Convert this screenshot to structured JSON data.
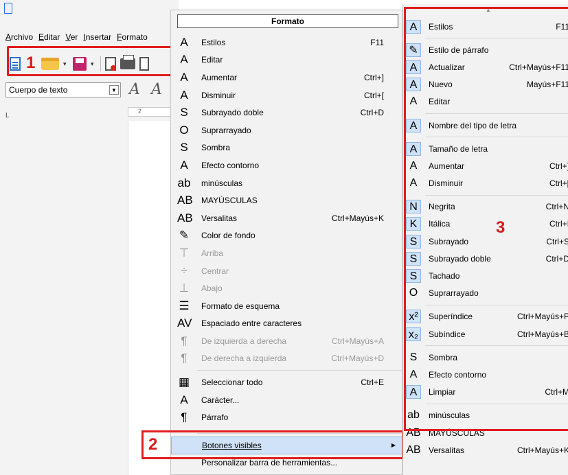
{
  "writer": {
    "menubar": [
      "Archivo",
      "Editar",
      "Ver",
      "Insertar",
      "Formato"
    ],
    "paragraph_style": "Cuerpo de texto",
    "ruler_marker": "L",
    "ruler_number": "2"
  },
  "callouts": {
    "one": "1",
    "two": "2",
    "three": "3"
  },
  "accent_color": "#e01d1d",
  "highlight_color": "#cfe2f7",
  "formato": {
    "title": "Formato",
    "items": [
      {
        "label": "Estilos",
        "shortcut": "F11",
        "icon": "estilos-icon",
        "glyph": "A"
      },
      {
        "label": "Editar",
        "shortcut": "",
        "icon": "editar-icon",
        "glyph": "A"
      },
      {
        "label": "Aumentar",
        "shortcut": "Ctrl+]",
        "icon": "aumentar-icon",
        "glyph": "A"
      },
      {
        "label": "Disminuir",
        "shortcut": "Ctrl+[",
        "icon": "disminuir-icon",
        "glyph": "A"
      },
      {
        "label": "Subrayado doble",
        "shortcut": "Ctrl+D",
        "icon": "subrayado-doble-icon",
        "glyph": "S"
      },
      {
        "label": "Suprarrayado",
        "shortcut": "",
        "icon": "suprarrayado-icon",
        "glyph": "O"
      },
      {
        "label": "Sombra",
        "shortcut": "",
        "icon": "sombra-icon",
        "glyph": "S"
      },
      {
        "label": "Efecto contorno",
        "shortcut": "",
        "icon": "contorno-icon",
        "glyph": "A"
      },
      {
        "label": "minúsculas",
        "shortcut": "",
        "icon": "minusculas-icon",
        "glyph": "ab"
      },
      {
        "label": "MAYÚSCULAS",
        "shortcut": "",
        "icon": "mayusculas-icon",
        "glyph": "AB"
      },
      {
        "label": "Versalitas",
        "shortcut": "Ctrl+Mayús+K",
        "icon": "versalitas-icon",
        "glyph": "AB"
      },
      {
        "label": "Color de fondo",
        "shortcut": "",
        "icon": "color-fondo-icon",
        "glyph": "✎"
      },
      {
        "label": "Arriba",
        "shortcut": "",
        "icon": "arriba-icon",
        "glyph": "⊤",
        "disabled": true
      },
      {
        "label": "Centrar",
        "shortcut": "",
        "icon": "centrar-icon",
        "glyph": "÷",
        "disabled": true
      },
      {
        "label": "Abajo",
        "shortcut": "",
        "icon": "abajo-icon",
        "glyph": "⊥",
        "disabled": true
      },
      {
        "label": "Formato de esquema",
        "shortcut": "",
        "icon": "esquema-icon",
        "glyph": "☰"
      },
      {
        "label": "Espaciado entre caracteres",
        "shortcut": "",
        "icon": "espaciado-icon",
        "glyph": "AV"
      },
      {
        "label": "De izquierda a derecha",
        "shortcut": "Ctrl+Mayús+A",
        "icon": "ltr-icon",
        "glyph": "¶",
        "disabled": true
      },
      {
        "label": "De derecha a izquierda",
        "shortcut": "Ctrl+Mayús+D",
        "icon": "rtl-icon",
        "glyph": "¶",
        "disabled": true
      },
      {
        "label": "Seleccionar todo",
        "shortcut": "Ctrl+E",
        "icon": "seleccionar-todo-icon",
        "glyph": "▦"
      },
      {
        "label": "Carácter...",
        "shortcut": "",
        "icon": "caracter-icon",
        "glyph": "A"
      },
      {
        "label": "Párrafo",
        "shortcut": "",
        "icon": "parrafo-icon",
        "glyph": "¶"
      }
    ],
    "visible_buttons": {
      "label": "Botones visibles"
    },
    "customize": {
      "label": "Personalizar barra de herramientas..."
    }
  },
  "visible_buttons_menu": {
    "groups": [
      [
        {
          "label": "Estilos",
          "shortcut": "F11",
          "icon": "estilos-icon",
          "glyph": "A",
          "checked": true
        }
      ],
      [
        {
          "label": "Estilo de párrafo",
          "shortcut": "",
          "icon": "estilo-parrafo-icon",
          "glyph": "✎",
          "checked": true
        },
        {
          "label": "Actualizar",
          "shortcut": "Ctrl+Mayús+F11",
          "icon": "actualizar-icon",
          "glyph": "A",
          "checked": true
        },
        {
          "label": "Nuevo",
          "shortcut": "Mayús+F11",
          "icon": "nuevo-icon",
          "glyph": "A",
          "checked": true
        },
        {
          "label": "Editar",
          "shortcut": "",
          "icon": "editar-icon",
          "glyph": "A",
          "checked": false
        }
      ],
      [
        {
          "label": "Nombre del tipo de letra",
          "shortcut": "",
          "icon": "nombre-letra-icon",
          "glyph": "A",
          "checked": true
        }
      ],
      [
        {
          "label": "Tamaño de letra",
          "shortcut": "",
          "icon": "tamano-letra-icon",
          "glyph": "A",
          "checked": true
        },
        {
          "label": "Aumentar",
          "shortcut": "Ctrl+]",
          "icon": "aumentar-icon",
          "glyph": "A",
          "checked": false
        },
        {
          "label": "Disminuir",
          "shortcut": "Ctrl+[",
          "icon": "disminuir-icon",
          "glyph": "A",
          "checked": false
        }
      ],
      [
        {
          "label": "Negrita",
          "shortcut": "Ctrl+N",
          "icon": "negrita-icon",
          "glyph": "N",
          "checked": true
        },
        {
          "label": "Itálica",
          "shortcut": "Ctrl+I",
          "icon": "italica-icon",
          "glyph": "K",
          "checked": true
        },
        {
          "label": "Subrayado",
          "shortcut": "Ctrl+S",
          "icon": "subrayado-icon",
          "glyph": "S",
          "checked": true
        },
        {
          "label": "Subrayado doble",
          "shortcut": "Ctrl+D",
          "icon": "subrayado-doble-icon",
          "glyph": "S",
          "checked": true
        },
        {
          "label": "Tachado",
          "shortcut": "",
          "icon": "tachado-icon",
          "glyph": "S",
          "checked": true
        },
        {
          "label": "Suprarrayado",
          "shortcut": "",
          "icon": "suprarrayado-icon",
          "glyph": "O",
          "checked": false
        }
      ],
      [
        {
          "label": "Superíndice",
          "shortcut": "Ctrl+Mayús+P",
          "icon": "superindice-icon",
          "glyph": "x²",
          "checked": true
        },
        {
          "label": "Subíndice",
          "shortcut": "Ctrl+Mayús+B",
          "icon": "subindice-icon",
          "glyph": "x₂",
          "checked": true
        }
      ],
      [
        {
          "label": "Sombra",
          "shortcut": "",
          "icon": "sombra-icon",
          "glyph": "S",
          "checked": false
        },
        {
          "label": "Efecto contorno",
          "shortcut": "",
          "icon": "contorno-icon",
          "glyph": "A",
          "checked": false
        },
        {
          "label": "Limpiar",
          "shortcut": "Ctrl+M",
          "icon": "limpiar-icon",
          "glyph": "A",
          "checked": true
        }
      ],
      [
        {
          "label": "minúsculas",
          "shortcut": "",
          "icon": "minusculas-icon",
          "glyph": "ab",
          "checked": false
        },
        {
          "label": "MAYÚSCULAS",
          "shortcut": "",
          "icon": "mayusculas-icon",
          "glyph": "AB",
          "checked": false
        },
        {
          "label": "Versalitas",
          "shortcut": "Ctrl+Mayús+K",
          "icon": "versalitas-icon",
          "glyph": "AB",
          "checked": false
        }
      ]
    ]
  }
}
